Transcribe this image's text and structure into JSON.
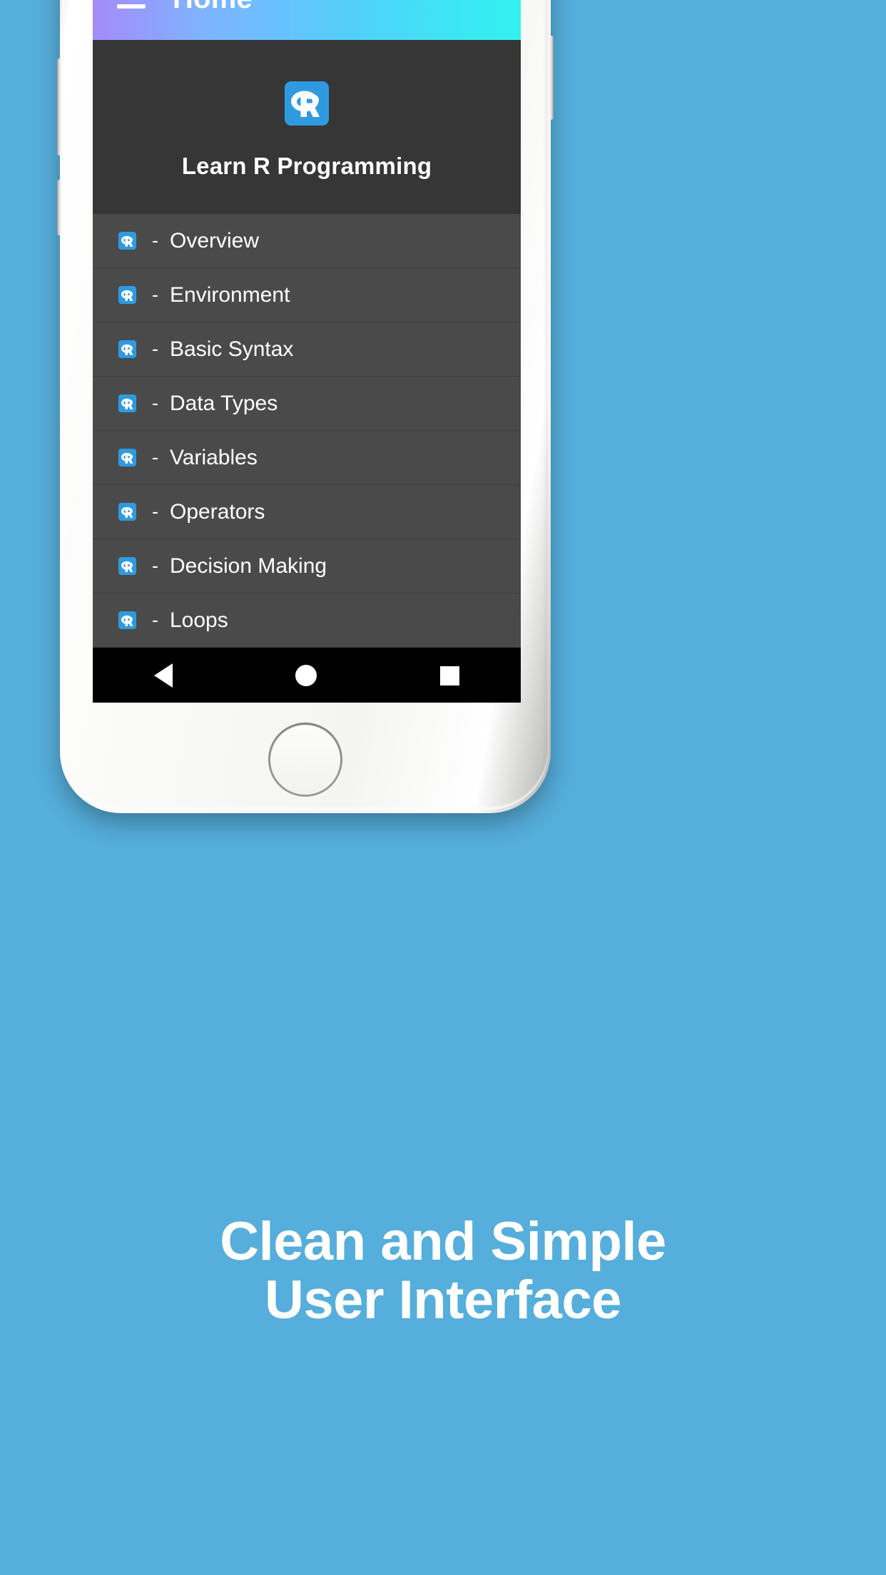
{
  "background": {
    "color": "#55AEDB"
  },
  "app": {
    "app_bar": {
      "menu_icon": "hamburger-menu-icon",
      "title": "Home",
      "gradient_from": "#A48BFB",
      "gradient_to": "#32F0EF"
    },
    "drawer": {
      "logo_icon": "r-logo-icon",
      "title": "Learn R Programming",
      "header_bg": "#363636",
      "list_bg": "#4A4A4A",
      "items": [
        {
          "icon": "r-logo-icon",
          "dash": "-",
          "label": "Overview"
        },
        {
          "icon": "r-logo-icon",
          "dash": "-",
          "label": "Environment"
        },
        {
          "icon": "r-logo-icon",
          "dash": "-",
          "label": "Basic Syntax"
        },
        {
          "icon": "r-logo-icon",
          "dash": "-",
          "label": "Data Types"
        },
        {
          "icon": "r-logo-icon",
          "dash": "-",
          "label": "Variables"
        },
        {
          "icon": "r-logo-icon",
          "dash": "-",
          "label": "Operators"
        },
        {
          "icon": "r-logo-icon",
          "dash": "-",
          "label": "Decision Making"
        },
        {
          "icon": "r-logo-icon",
          "dash": "-",
          "label": "Loops"
        }
      ]
    },
    "nav_bar": {
      "back": "back-triangle-icon",
      "home": "home-circle-icon",
      "recents": "recents-square-icon"
    }
  },
  "caption": {
    "line1": "Clean and Simple",
    "line2": "User Interface",
    "color": "#FFFFFF"
  }
}
